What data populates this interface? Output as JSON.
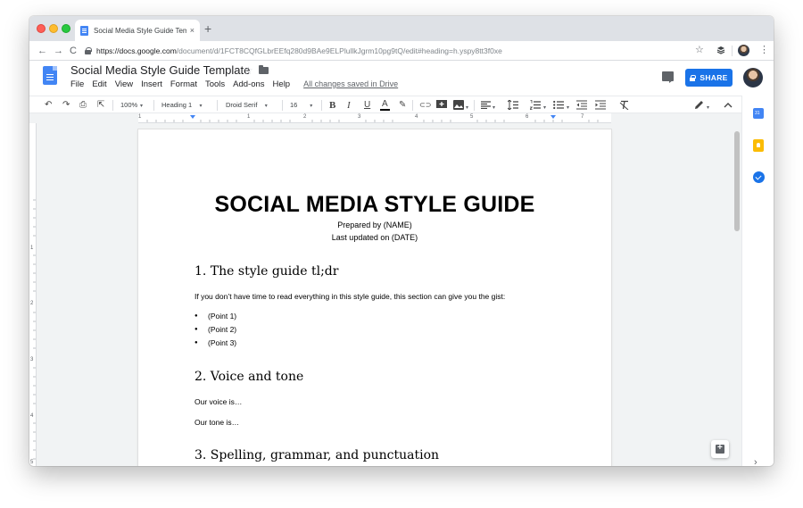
{
  "browser": {
    "tab_title": "Social Media Style Guide Temp",
    "tab_close": "×",
    "new_tab": "+",
    "nav_back": "←",
    "nav_forward": "→",
    "nav_reload": "C",
    "url_host": "https://docs.google.com",
    "url_path": "/document/d/1FCT8CQfGLbrEEfq280d9BAe9ELPlullkJgrm10pg9tQ/edit#heading=h.yspy8tt3f0xe",
    "star": "☆",
    "menu": "⋮"
  },
  "doc": {
    "title": "Social Media Style Guide Template",
    "title_star": "☆",
    "menus": [
      "File",
      "Edit",
      "View",
      "Insert",
      "Format",
      "Tools",
      "Add-ons",
      "Help"
    ],
    "saved_status": "All changes saved in Drive",
    "share_label": "SHARE"
  },
  "toolbar": {
    "undo": "↶",
    "redo": "↷",
    "print": "⎙",
    "paint_format": "⇱",
    "zoom": "100%",
    "style": "Heading 1",
    "font": "Droid Serif",
    "size": "16",
    "bold": "B",
    "italic": "I",
    "underline": "U",
    "text_color": "A",
    "highlight": "✎",
    "link": "⊂⊃",
    "caret": "▾"
  },
  "ruler": {
    "h_numbers": [
      "1",
      "1",
      "2",
      "3",
      "4",
      "5",
      "6",
      "7"
    ],
    "v_numbers": [
      "1",
      "2",
      "3",
      "4",
      "5"
    ]
  },
  "content": {
    "title": "SOCIAL MEDIA STYLE GUIDE",
    "prepared_by": "Prepared by (NAME)",
    "last_updated": "Last updated on (DATE)",
    "h1_1": "1. The style guide tl;dr",
    "p_1": "If you don’t have time to read everything in this style guide, this section can give you the gist:",
    "bullets": [
      "(Point 1)",
      "(Point 2)",
      "(Point 3)"
    ],
    "h1_2": "2. Voice and tone",
    "p_2": "Our voice is…",
    "p_3": "Our tone is…",
    "h1_3": "3. Spelling, grammar, and punctuation"
  },
  "side_panel": {
    "expand": "›"
  },
  "colors": {
    "share_blue": "#1a73e8",
    "docs_blue": "#4285f4",
    "canvas_gray": "#f1f3f4"
  }
}
